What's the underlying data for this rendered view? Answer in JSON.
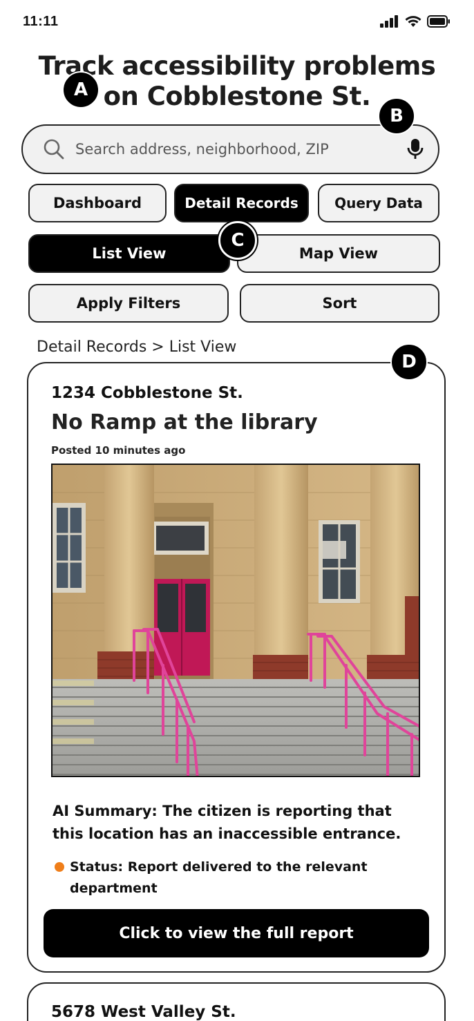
{
  "status_bar": {
    "time": "11:11"
  },
  "title": {
    "line1": "Track accessibility problems",
    "line2": "on Cobblestone St."
  },
  "markers": {
    "a": "A",
    "b": "B",
    "c": "C",
    "d": "D"
  },
  "search": {
    "placeholder": "Search address, neighborhood, ZIP"
  },
  "nav_tabs": {
    "dashboard": "Dashboard",
    "detail_records": "Detail Records",
    "query_data": "Query Data"
  },
  "view_toggle": {
    "list": "List View",
    "map": "Map View"
  },
  "actions": {
    "filters": "Apply Filters",
    "sort": "Sort"
  },
  "breadcrumb": "Detail Records > List View",
  "records": [
    {
      "address": "1234 Cobblestone St.",
      "title": "No Ramp at the library",
      "posted": "Posted 10 minutes ago",
      "summary": "AI Summary: The citizen is reporting that this location has an inaccessible entrance.",
      "status": "Status: Report delivered to the relevant department",
      "status_color": "#ef7e1a",
      "button": "Click to view the full report"
    },
    {
      "address": "5678 West Valley St."
    }
  ],
  "colors": {
    "accent": "#000000",
    "status_orange": "#ef7e1a",
    "railing_pink": "#e0449a",
    "door_magenta": "#c01856"
  }
}
